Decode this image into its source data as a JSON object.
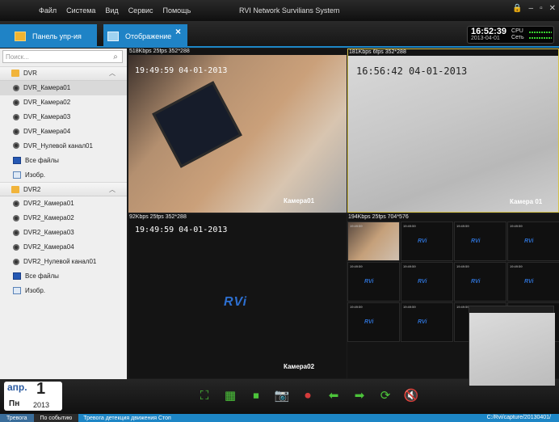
{
  "menu": [
    "Файл",
    "Система",
    "Вид",
    "Сервис",
    "Помощь"
  ],
  "app_title": "RVI Network Survilians System",
  "tabs": [
    {
      "label": "Панель упр-ия"
    },
    {
      "label": "Отображение",
      "close": "×"
    }
  ],
  "clock": {
    "time": "16:52:39",
    "date": "2013-04-01",
    "cpu_label": "CPU",
    "net_label": "Сеть"
  },
  "sidebar": {
    "search_placeholder": "Поиск...",
    "groups": [
      {
        "label": "DVR",
        "items": [
          "DVR_Камера01",
          "DVR_Камера02",
          "DVR_Камера03",
          "DVR_Камера04",
          "DVR_Нулевой канал01",
          "Все файлы",
          "Изобр."
        ]
      },
      {
        "label": "DVR2",
        "items": [
          "DVR2_Камера01",
          "DVR2_Камера02",
          "DVR2_Камера03",
          "DVR2_Камера04",
          "DVR2_Нулевой канал01",
          "Все файлы",
          "Изобр."
        ]
      }
    ]
  },
  "panes": [
    {
      "header": "518Kbps 25fps 352*288",
      "timestamp": "19:49:59 04-01-2013",
      "camera": "Камера01"
    },
    {
      "header": "181Kbps 6fps 352*288",
      "timestamp": "16:56:42 04-01-2013",
      "camera": "Камера 01"
    },
    {
      "header": "92Kbps 25fps 352*288",
      "timestamp": "19:49:59 04-01-2013",
      "camera": "Камера02",
      "logo": "RVi"
    },
    {
      "header": "194Kbps 25fps 704*576"
    }
  ],
  "date": {
    "month": "апр.",
    "day": "1",
    "weekday": "Пн",
    "year": "2013"
  },
  "status": {
    "btn1": "Тревога",
    "btn2": "По событию",
    "alarm": "Тревога детекция движения Стоп",
    "path": "C:/Rvi/capture/20130401/"
  }
}
